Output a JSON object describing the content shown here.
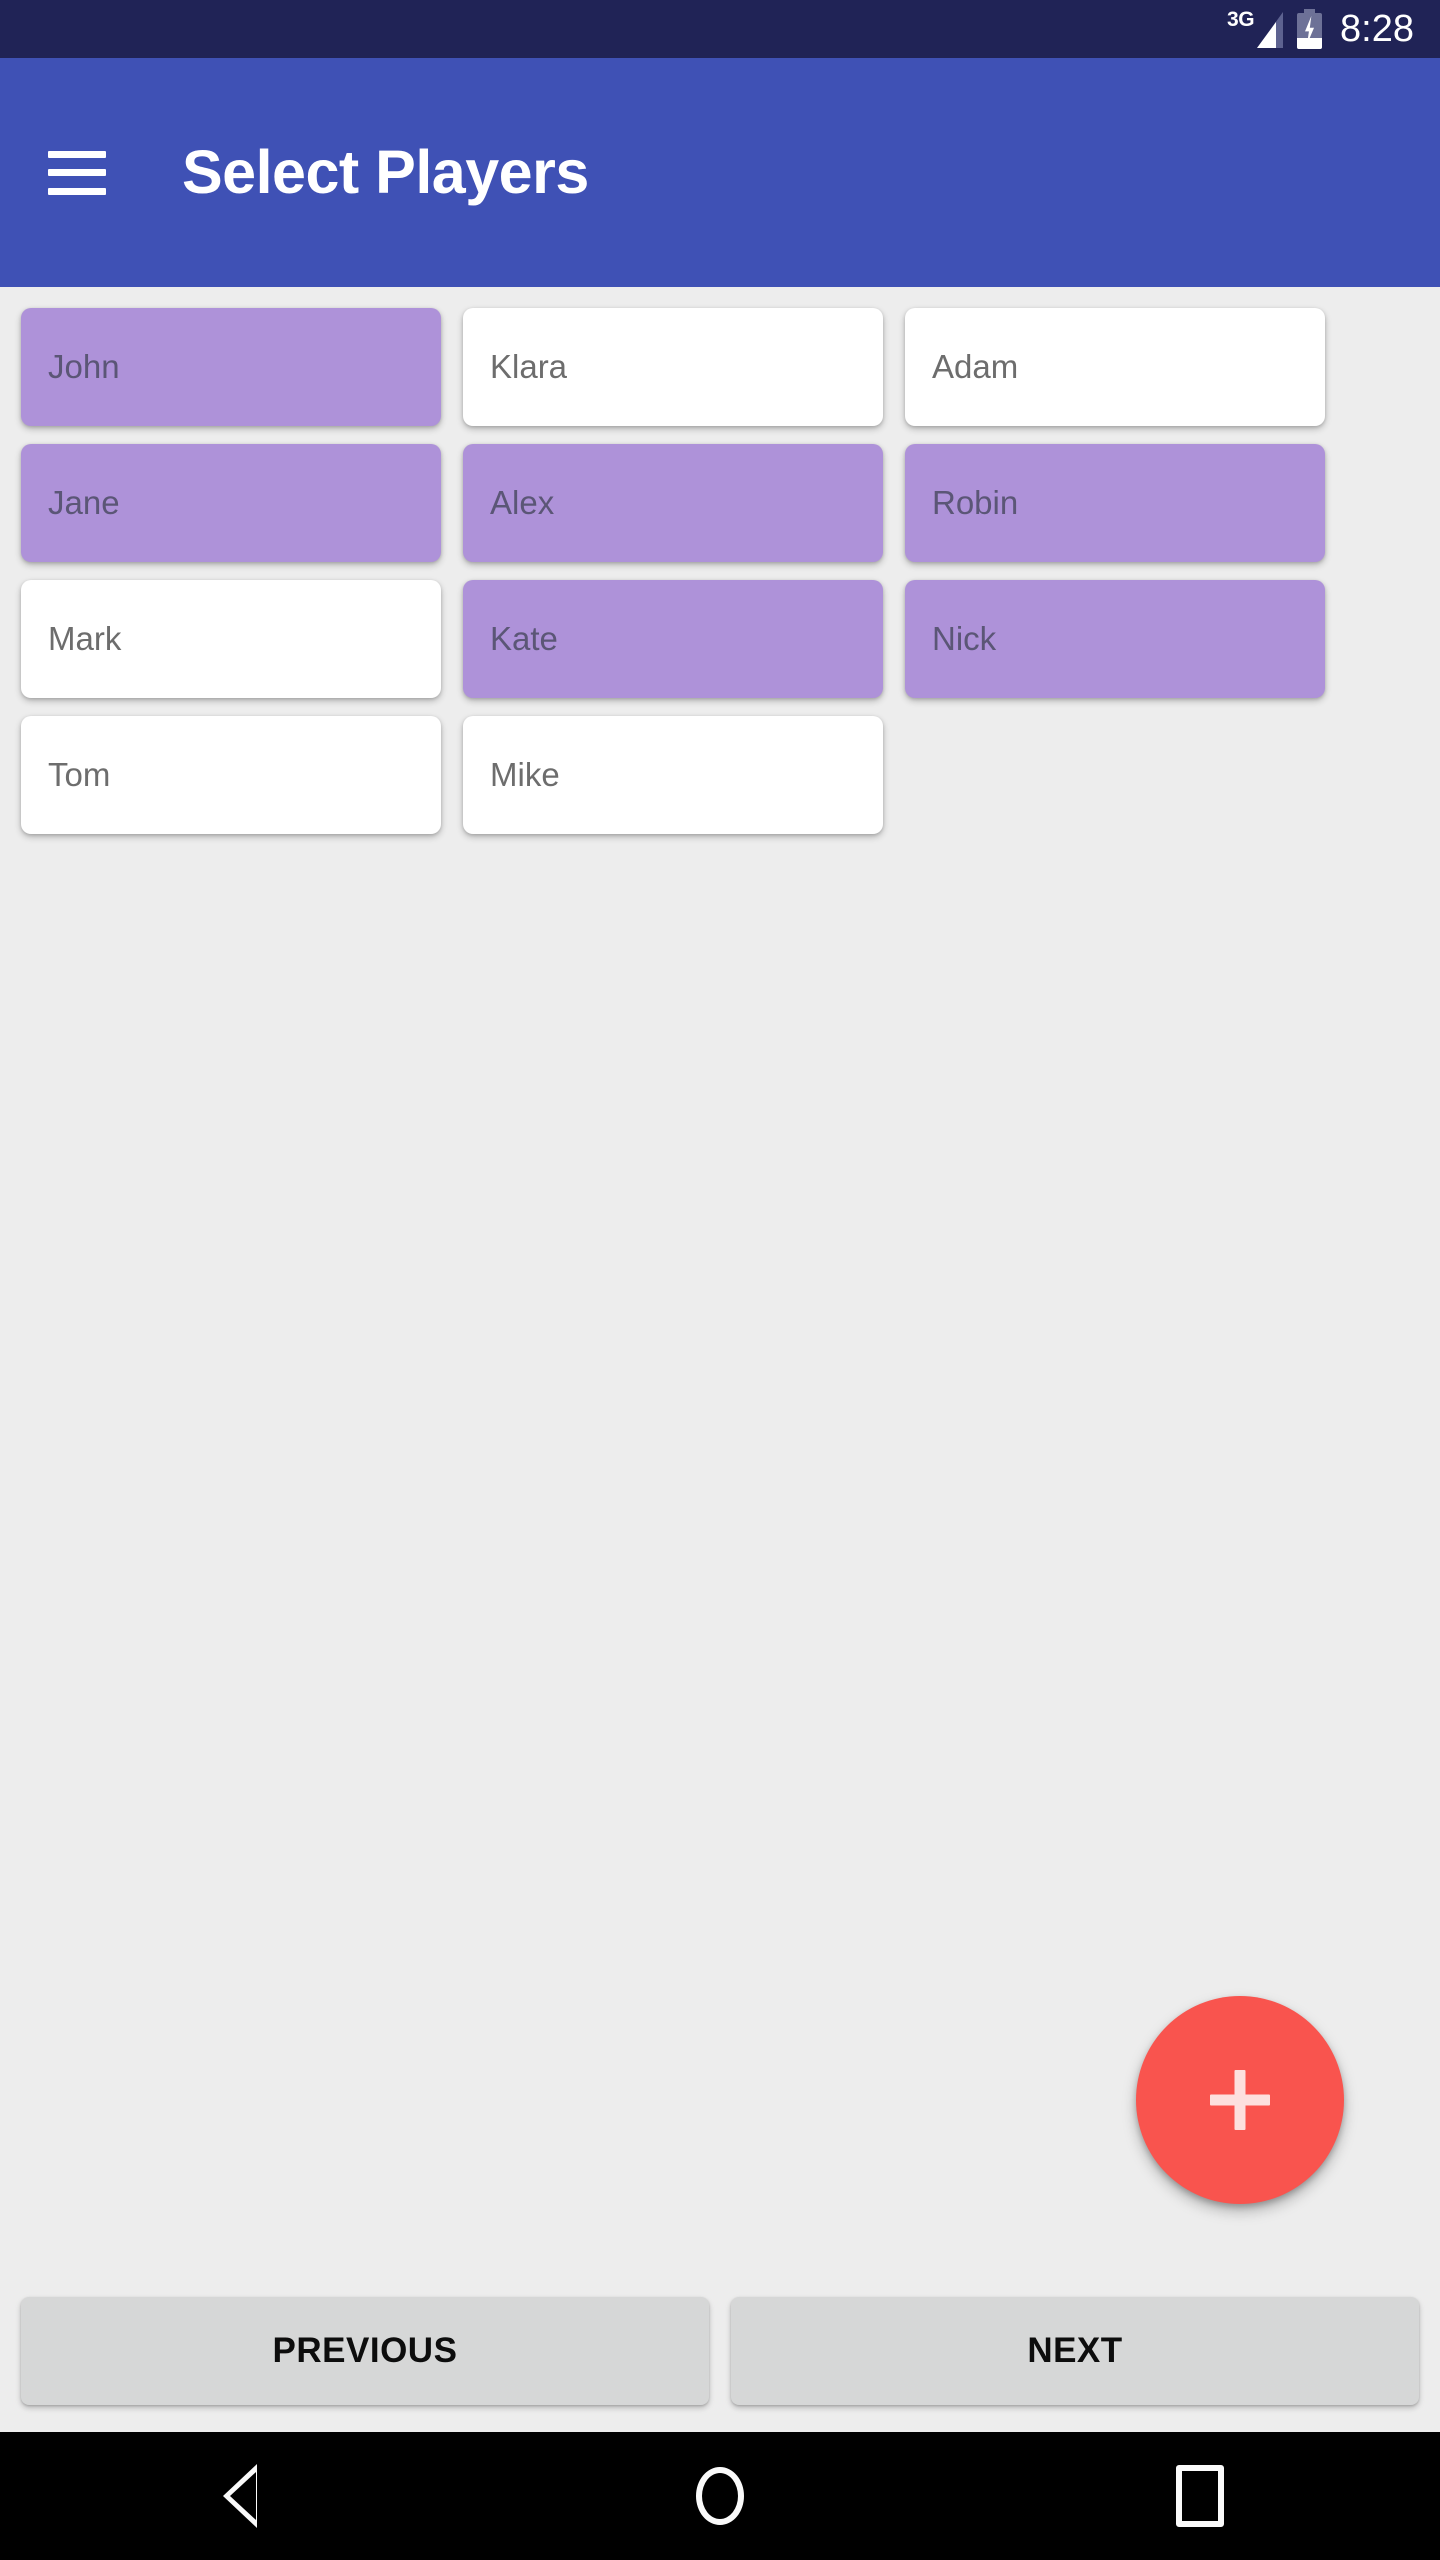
{
  "status_bar": {
    "network": "3G",
    "time": "8:28",
    "battery_state": "charging",
    "background_color": "#202356"
  },
  "app_bar": {
    "title": "Select Players",
    "menu_icon": "hamburger-menu-icon",
    "background_color": "#3f51b5"
  },
  "players": [
    {
      "name": "John",
      "selected": true
    },
    {
      "name": "Klara",
      "selected": false
    },
    {
      "name": "Adam",
      "selected": false
    },
    {
      "name": "Jane",
      "selected": true
    },
    {
      "name": "Alex",
      "selected": true
    },
    {
      "name": "Robin",
      "selected": true
    },
    {
      "name": "Mark",
      "selected": false
    },
    {
      "name": "Kate",
      "selected": true
    },
    {
      "name": "Nick",
      "selected": true
    },
    {
      "name": "Tom",
      "selected": false
    },
    {
      "name": "Mike",
      "selected": false
    }
  ],
  "fab": {
    "icon": "plus-icon",
    "color": "#f9544e"
  },
  "bottom_bar": {
    "previous_label": "PREVIOUS",
    "next_label": "NEXT",
    "button_color": "#d6d7d7"
  },
  "system_nav": {
    "back_icon": "triangle-back-icon",
    "home_icon": "circle-home-icon",
    "recents_icon": "square-recents-icon"
  },
  "colors": {
    "selected_card": "#ae92d9",
    "unselected_card": "#ffffff",
    "page_background": "#ededed",
    "accent": "#3f51b5"
  }
}
